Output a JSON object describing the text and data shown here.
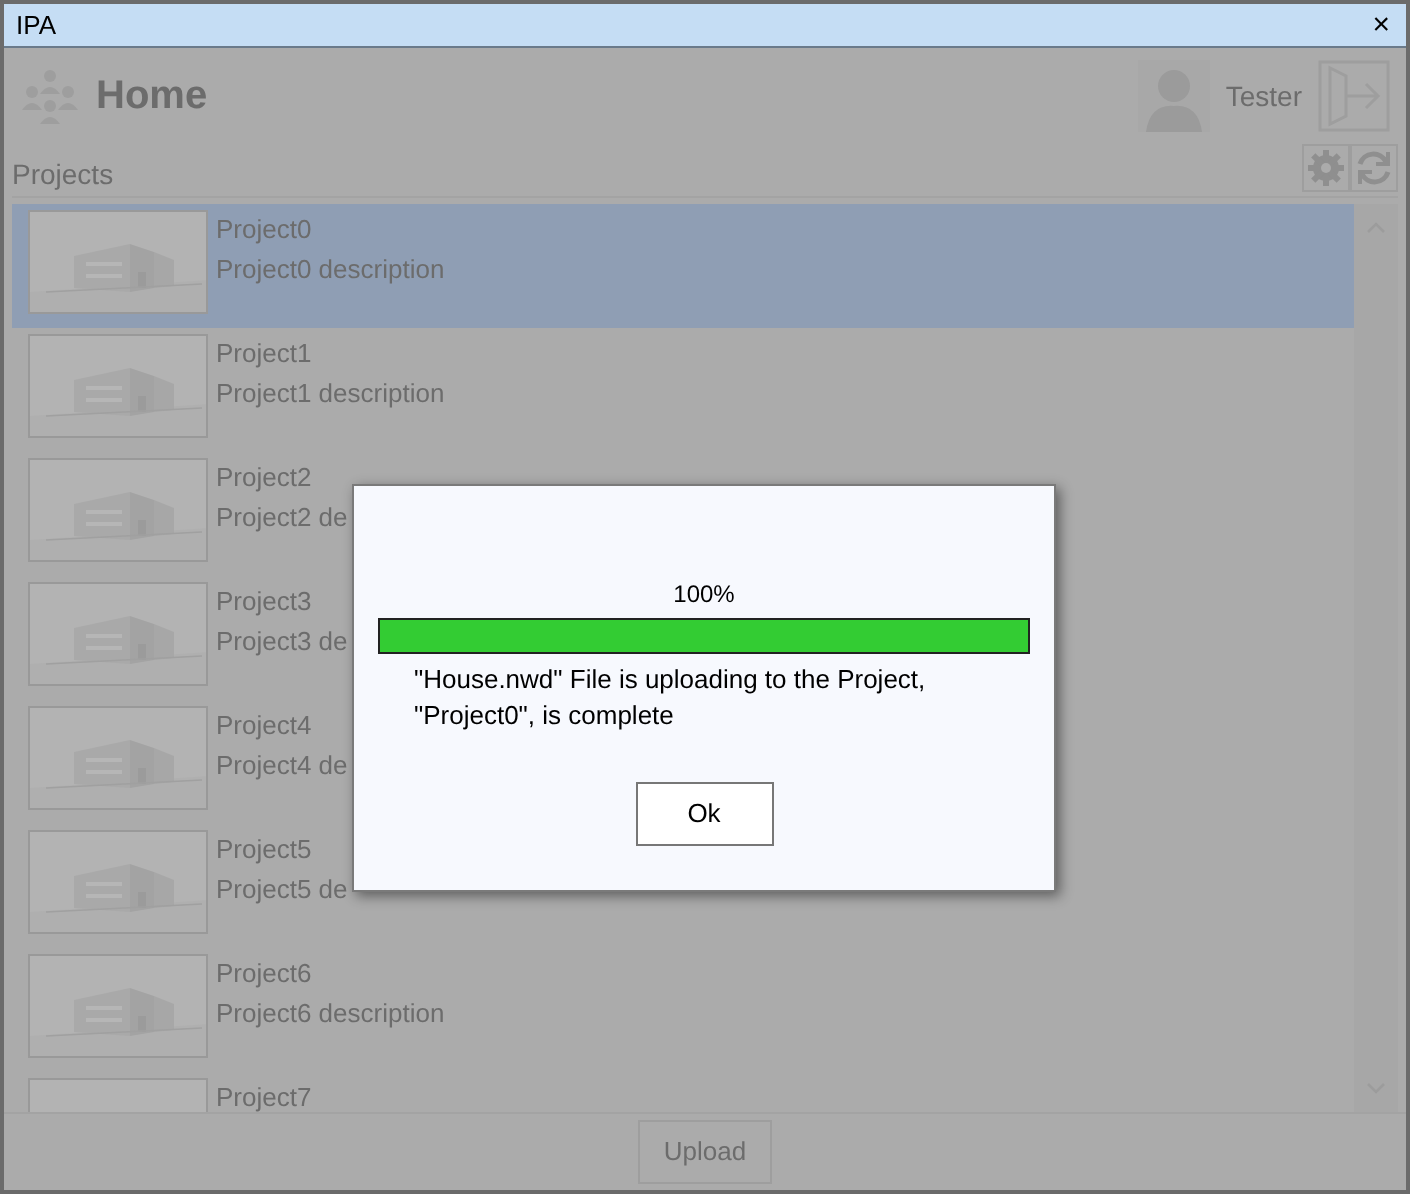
{
  "window": {
    "title": "IPA",
    "close": "×"
  },
  "header": {
    "title": "Home",
    "user": "Tester"
  },
  "section": {
    "label": "Projects"
  },
  "projects": [
    {
      "name": "Project0",
      "description": "Project0 description",
      "selected": true
    },
    {
      "name": "Project1",
      "description": "Project1 description",
      "selected": false
    },
    {
      "name": "Project2",
      "description": "Project2 de",
      "selected": false
    },
    {
      "name": "Project3",
      "description": "Project3 de",
      "selected": false
    },
    {
      "name": "Project4",
      "description": "Project4 de",
      "selected": false
    },
    {
      "name": "Project5",
      "description": "Project5 de",
      "selected": false
    },
    {
      "name": "Project6",
      "description": "Project6 description",
      "selected": false
    },
    {
      "name": "Project7",
      "selected": false
    }
  ],
  "footer": {
    "button": "Upload"
  },
  "dialog": {
    "percent": "100%",
    "level": 1,
    "message": "\"House.nwd\" File is uploading to the Project, \"Project0\", is complete",
    "button": "Ok"
  }
}
